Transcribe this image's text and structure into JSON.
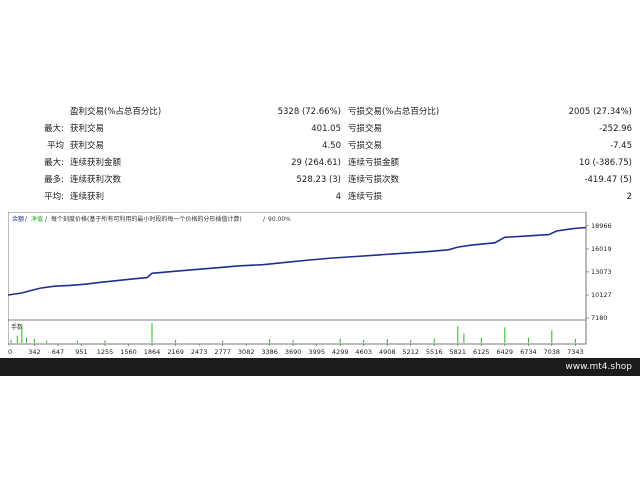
{
  "stats": {
    "rows": [
      {
        "l1": "",
        "l2": "盈利交易(%占总百分比)",
        "v1": "5328 (72.66%)",
        "l3": "亏损交易(%占总百分比)",
        "v2": "2005 (27.34%)"
      },
      {
        "l1": "最大:",
        "l2": "获利交易",
        "v1": "401.05",
        "l3": "亏损交易",
        "v2": "-252.96"
      },
      {
        "l1": "平均",
        "l2": "获利交易",
        "v1": "4.50",
        "l3": "亏损交易",
        "v2": "-7.45"
      },
      {
        "l1": "最大:",
        "l2": "连续获利金额",
        "v1": "29 (264.61)",
        "l3": "连续亏损金额",
        "v2": "10 (-386.75)"
      },
      {
        "l1": "最多:",
        "l2": "连续获利次数",
        "v1": "528.23 (3)",
        "l3": "连续亏损次数",
        "v2": "-419.47 (5)"
      },
      {
        "l1": "平均:",
        "l2": "连续获利",
        "v1": "4",
        "l3": "连续亏损",
        "v2": "2"
      }
    ]
  },
  "chart": {
    "legend": {
      "balance": "余额",
      "equity": "净值",
      "model": "每个刻度价格(基于所有可利用的最小时段的每一个价格的分形插值计算)",
      "quality": "90.00%"
    },
    "volume_label": "手数",
    "colors": {
      "balance": "#1f2f8c",
      "volume": "#22bb22",
      "frame": "#555555",
      "legend_balance": "#1f2f8c",
      "legend_equity": "#22aa22"
    }
  },
  "chart_data": {
    "type": "line",
    "title": "",
    "xlabel": "",
    "ylabel": "",
    "x_ticks": [
      0,
      342,
      647,
      951,
      1255,
      1560,
      1864,
      2169,
      2473,
      2777,
      3082,
      3386,
      3690,
      3995,
      4299,
      4603,
      4908,
      5212,
      5516,
      5821,
      6125,
      6429,
      6734,
      7038,
      7343
    ],
    "y_ticks": [
      7180,
      10127,
      13073,
      16019,
      18966
    ],
    "xlim": [
      0,
      7480
    ],
    "ylim": [
      7180,
      19200
    ],
    "series": [
      {
        "x": [
          0,
          180,
          280,
          420,
          600,
          800,
          1000,
          1200,
          1400,
          1600,
          1800,
          1864,
          2100,
          2400,
          2700,
          3000,
          3300,
          3600,
          3900,
          4200,
          4500,
          4800,
          5100,
          5400,
          5700,
          5821,
          6000,
          6300,
          6429,
          6700,
          7000,
          7100,
          7300,
          7480
        ],
        "y": [
          10120,
          10380,
          10650,
          11000,
          11250,
          11350,
          11500,
          11750,
          11950,
          12150,
          12350,
          12900,
          13100,
          13350,
          13600,
          13850,
          14000,
          14300,
          14600,
          14850,
          15050,
          15250,
          15450,
          15650,
          15900,
          16250,
          16500,
          16800,
          17500,
          17650,
          17850,
          18300,
          18600,
          18750
        ]
      }
    ],
    "volume": {
      "x": [
        40,
        120,
        180,
        240,
        342,
        500,
        900,
        1255,
        1864,
        2169,
        2777,
        3386,
        3690,
        4299,
        4603,
        4908,
        5212,
        5516,
        5821,
        5900,
        6125,
        6429,
        6734,
        7038,
        7343
      ],
      "y": [
        0.15,
        0.35,
        0.8,
        0.25,
        0.2,
        0.12,
        0.1,
        0.12,
        0.95,
        0.15,
        0.12,
        0.18,
        0.14,
        0.2,
        0.15,
        0.18,
        0.14,
        0.22,
        0.8,
        0.45,
        0.25,
        0.75,
        0.25,
        0.6,
        0.2
      ]
    }
  },
  "footer": {
    "site": "www.mt4.shop"
  }
}
